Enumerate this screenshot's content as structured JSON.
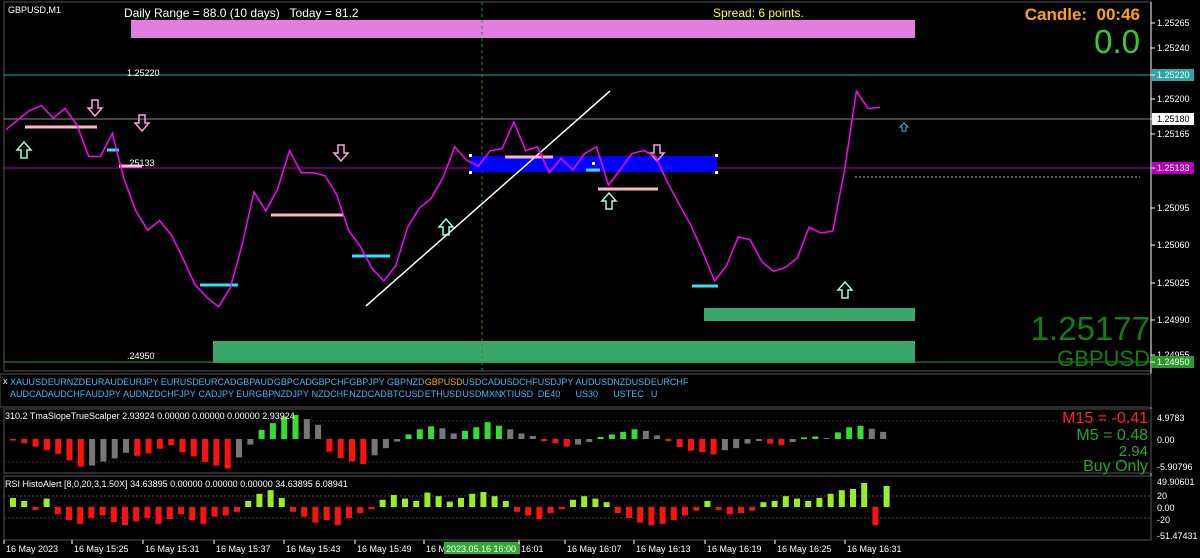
{
  "window": {
    "title": "GBPUSD,M1"
  },
  "header": {
    "daily_range": "Daily Range = 88.0 (10 days)   Today = 81.2",
    "spread": "Spread: 6 points.",
    "candle": "Candle:  00:46",
    "candle_value": "0.0"
  },
  "overlay": {
    "big_price": "1.25177",
    "big_symbol": "GBPUSD"
  },
  "colors": {
    "price_line": "#ff00ff",
    "up_arrow": "#9fffd4",
    "down_arrow": "#ff9fe0",
    "grid": "#1f3f1f",
    "axis": "#ffffff",
    "green_zone": "#3aa66b",
    "pink_zone": "#e27ee0",
    "blue_zone": "#0000ff",
    "bar_green": "#33dd33",
    "bar_red": "#ff1111",
    "bar_gray": "#777777",
    "bar_lime": "#99ee22",
    "indicator_text_red": "#ff2222",
    "indicator_text_green": "#22aa22"
  },
  "chart_data": [
    {
      "type": "line",
      "title": "GBPUSD,M1",
      "y_ticks": [
        "1.25265",
        "1.25240",
        "1.25220",
        "1.25200",
        "1.25180",
        "1.25165",
        "1.25133",
        "1.25095",
        "1.25060",
        "1.25025",
        "1.24990",
        "1.24955",
        "1.24950"
      ],
      "levels": [
        {
          "label": "1.25220",
          "value": 1.2522
        },
        {
          "label": "1.25180",
          "value": 1.2518
        },
        {
          "label": "1.25133",
          "value": 1.25133
        },
        {
          "label": "1.24950",
          "value": 1.2495
        }
      ],
      "chart_labels": [
        ".25133",
        ".24950"
      ],
      "x_ticks": [
        "16 May 2023",
        "16 May 15:25",
        "16 May 15:31",
        "16 May 15:37",
        "16 May 15:43",
        "16 May 15:49",
        "16 M",
        "2023.05.16 16:00",
        "16:01",
        "16 May 16:07",
        "16 May 16:13",
        "16 May 16:19",
        "16 May 16:25",
        "16 May 16:31"
      ],
      "series": [
        {
          "values": [
            1.2517,
            1.2518,
            1.2519,
            1.25195,
            1.25182,
            1.25192,
            1.25175,
            1.25142,
            1.25142,
            1.25166,
            1.25118,
            1.25085,
            1.25065,
            1.25075,
            1.2506,
            1.25035,
            1.25008,
            1.24995,
            1.24985,
            1.25005,
            1.2505,
            1.25105,
            1.25085,
            1.25108,
            1.25148,
            1.25125,
            1.25125,
            1.25122,
            1.25102,
            1.25065,
            1.25048,
            1.25025,
            1.25012,
            1.25028,
            1.25068,
            1.25088,
            1.25098,
            1.2512,
            1.25152,
            1.25138,
            1.25132,
            1.25148,
            1.2515,
            1.25178,
            1.25148,
            1.25152,
            1.25125,
            1.2514,
            1.25128,
            1.25145,
            1.25152,
            1.25112,
            1.25128,
            1.25145,
            1.25148,
            1.25142,
            1.25115,
            1.25092,
            1.2507,
            1.25042,
            1.25012,
            1.25028,
            1.25058,
            1.25055,
            1.25032,
            1.25022,
            1.25026,
            1.25036,
            1.25068,
            1.25062,
            1.25064,
            1.25128,
            1.2521,
            1.25192,
            1.25193
          ]
        }
      ]
    },
    {
      "type": "bar",
      "title": "310.2 TmaSlopeTrueScalper 2.93924 0.00000 0.00000 0.00000 2.93924",
      "y_ticks": [
        "4.9783",
        "0.00",
        "-5.90796"
      ],
      "ylim": [
        -5.90796,
        4.9783
      ],
      "values": [
        -0.3,
        -0.8,
        -1.5,
        -2.2,
        -2.9,
        -4.2,
        -5.4,
        -5.2,
        -4.4,
        -3.8,
        -2.7,
        -3.3,
        -2.8,
        -1.9,
        -1.2,
        -2.6,
        -3.4,
        -4.5,
        -5.2,
        -5.8,
        -3.6,
        -1.1,
        1.8,
        3.1,
        4.4,
        4.7,
        3.9,
        2.8,
        -2.5,
        -3.7,
        -4.4,
        -4.9,
        -3.2,
        -1.8,
        -0.5,
        0.9,
        1.9,
        2.5,
        2.1,
        1.1,
        1.6,
        2.3,
        3.3,
        2.6,
        1.9,
        1.1,
        0.6,
        -0.4,
        -0.8,
        -1.5,
        -1.1,
        -0.6,
        0.4,
        0.9,
        1.4,
        1.9,
        1.6,
        0.7,
        -0.4,
        -1.6,
        -2.3,
        -2.6,
        -3.0,
        -2.2,
        -1.8,
        -0.9,
        -0.4,
        -0.9,
        -1.2,
        -0.6,
        0.3,
        0.5,
        0.2,
        1.3,
        2.3,
        2.6,
        2.0,
        1.4
      ],
      "colors": [
        "red",
        "red",
        "red",
        "red",
        "red",
        "red",
        "red",
        "gray",
        "gray",
        "gray",
        "gray",
        "red",
        "red",
        "red",
        "red",
        "red",
        "red",
        "red",
        "red",
        "red",
        "gray",
        "gray",
        "green",
        "green",
        "green",
        "green",
        "gray",
        "gray",
        "red",
        "red",
        "red",
        "red",
        "gray",
        "gray",
        "gray",
        "green",
        "green",
        "green",
        "gray",
        "gray",
        "green",
        "green",
        "green",
        "green",
        "gray",
        "gray",
        "gray",
        "red",
        "red",
        "red",
        "gray",
        "gray",
        "green",
        "green",
        "green",
        "green",
        "gray",
        "gray",
        "red",
        "red",
        "red",
        "red",
        "red",
        "gray",
        "gray",
        "gray",
        "gray",
        "red",
        "red",
        "gray",
        "green",
        "green",
        "gray",
        "green",
        "green",
        "green",
        "gray",
        "gray"
      ],
      "labels": [
        {
          "text": "M15 = -0.41",
          "color": "red"
        },
        {
          "text": "M5 = 0.48",
          "color": "green"
        },
        {
          "text": "2.94",
          "color": "green"
        },
        {
          "text": "Buy Only",
          "color": "green"
        }
      ]
    },
    {
      "type": "bar",
      "title": "RSI HistoAlert [8,0,20,3,1.50X] 34.63895 0.00000 0.00000 0.00000 34.63895 6.08941",
      "y_ticks": [
        "49.90601",
        "20",
        "0.00",
        "-20",
        "-51.47431"
      ],
      "ylim": [
        -51.47431,
        49.90601
      ],
      "values": [
        15,
        10,
        -5,
        14,
        -12,
        -22,
        -28,
        -18,
        -14,
        -25,
        -30,
        -24,
        -18,
        -28,
        -20,
        -12,
        -22,
        -28,
        -16,
        -14,
        -8,
        10,
        22,
        28,
        15,
        -8,
        -16,
        -26,
        -22,
        -30,
        -18,
        -10,
        -4,
        12,
        20,
        14,
        10,
        24,
        18,
        9,
        15,
        22,
        25,
        18,
        10,
        -8,
        -14,
        -20,
        -10,
        -4,
        12,
        18,
        14,
        8,
        -10,
        -18,
        -26,
        -30,
        -28,
        -22,
        -14,
        -6,
        10,
        -5,
        -12,
        -10,
        -6,
        8,
        10,
        18,
        14,
        10,
        15,
        22,
        28,
        30,
        40,
        -30,
        35
      ]
    }
  ],
  "symbols": {
    "row1": [
      "XAUUSD",
      "EURNZD",
      "EURAUD",
      "EURJPY",
      "EURUSD",
      "EURCAD",
      "GBPAUD",
      "GBPCAD",
      "GBPCHF",
      "GBPJPY",
      "GBPNZD",
      "GBPUSD",
      "USDCAD",
      "USDCHF",
      "USDJPY",
      "AUDUSD",
      "NZDUSD",
      "EURCHF"
    ],
    "row2": [
      "AUDCAD",
      "AUDCHF",
      "AUDJPY",
      "AUDNZD",
      "CHFJPY",
      "CADJPY",
      "EURGBP",
      "NZDJPY",
      "NZDCHF",
      "NZDCAD",
      "BTCUSD",
      "ETHUSD",
      "USDMXN",
      "XTIUSD",
      "DE40",
      "US30",
      "USTEC",
      "U"
    ],
    "active": "GBPUSD",
    "close_label": "x"
  }
}
